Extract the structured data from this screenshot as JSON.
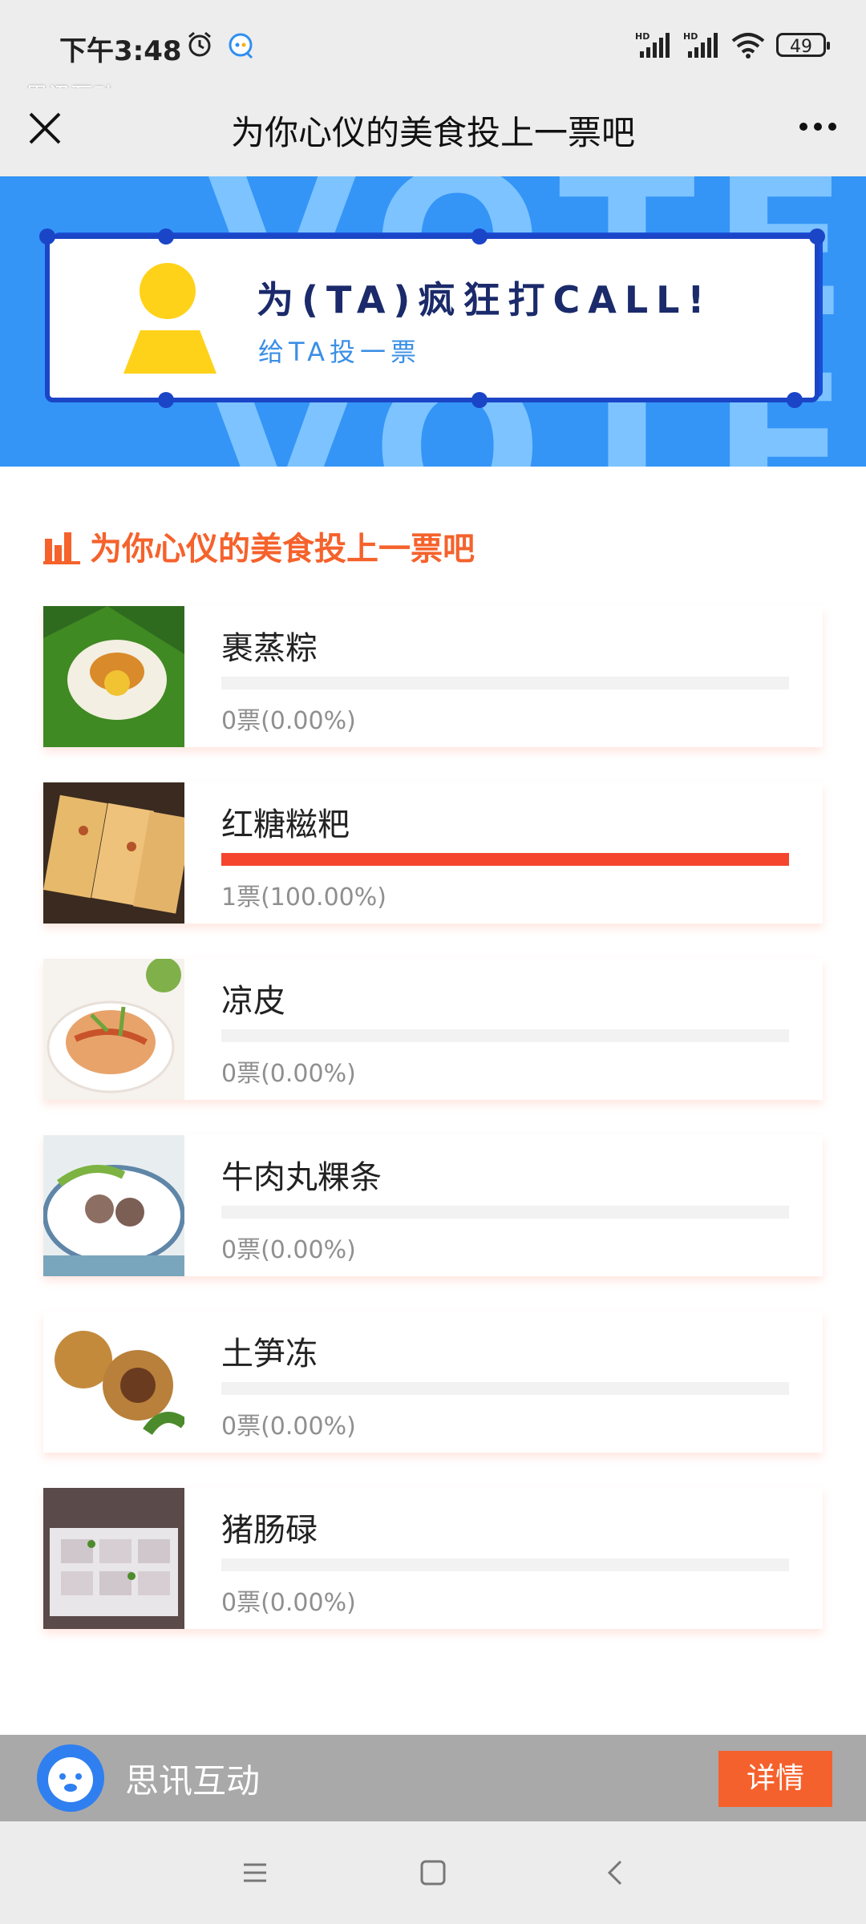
{
  "status_bar": {
    "time": "下午3:48",
    "battery": "49",
    "alarm_icon": "alarm-icon",
    "app_icon": "chat-app-icon"
  },
  "watermark": "思讯互动",
  "title_bar": {
    "title": "为你心仪的美食投上一票吧",
    "close_icon": "close-icon",
    "more_icon": "more-icon"
  },
  "banner": {
    "bg_text": "VOTE",
    "main": "为(TA)疯狂打CALL!",
    "sub": "给TA投一票",
    "bg_color": "#3495f7",
    "accent": "#1b45c7"
  },
  "section": {
    "title": "为你心仪的美食投上一票吧",
    "accent": "#f5622c"
  },
  "items": [
    {
      "name": "裹蒸粽",
      "count": "0票(0.00%)",
      "fraction": 0.0
    },
    {
      "name": "红糖糍粑",
      "count": "1票(100.00%)",
      "fraction": 1.0
    },
    {
      "name": "凉皮",
      "count": "0票(0.00%)",
      "fraction": 0.0
    },
    {
      "name": "牛肉丸粿条",
      "count": "0票(0.00%)",
      "fraction": 0.0
    },
    {
      "name": "土笋冻",
      "count": "0票(0.00%)",
      "fraction": 0.0
    },
    {
      "name": "猪肠碌",
      "count": "0票(0.00%)",
      "fraction": 0.0
    }
  ],
  "footer": {
    "name": "思讯互动",
    "button": "详情",
    "button_color": "#f5612c"
  }
}
